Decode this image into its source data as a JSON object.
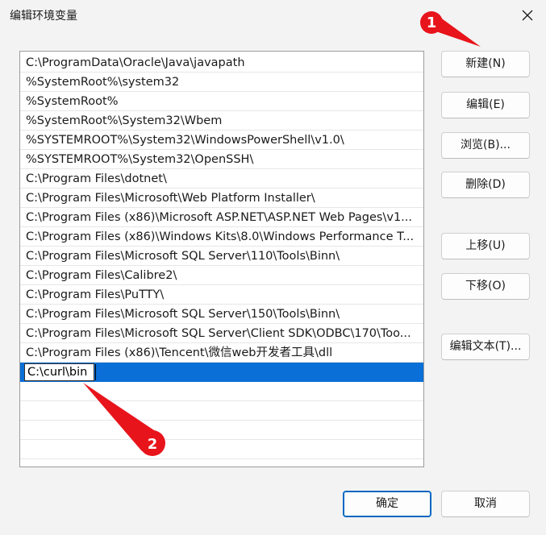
{
  "window": {
    "title": "编辑环境变量"
  },
  "paths": [
    "C:\\ProgramData\\Oracle\\Java\\javapath",
    "%SystemRoot%\\system32",
    "%SystemRoot%",
    "%SystemRoot%\\System32\\Wbem",
    "%SYSTEMROOT%\\System32\\WindowsPowerShell\\v1.0\\",
    "%SYSTEMROOT%\\System32\\OpenSSH\\",
    "C:\\Program Files\\dotnet\\",
    "C:\\Program Files\\Microsoft\\Web Platform Installer\\",
    "C:\\Program Files (x86)\\Microsoft ASP.NET\\ASP.NET Web Pages\\v1...",
    "C:\\Program Files (x86)\\Windows Kits\\8.0\\Windows Performance T...",
    "C:\\Program Files\\Microsoft SQL Server\\110\\Tools\\Binn\\",
    "C:\\Program Files\\Calibre2\\",
    "C:\\Program Files\\PuTTY\\",
    "C:\\Program Files\\Microsoft SQL Server\\150\\Tools\\Binn\\",
    "C:\\Program Files\\Microsoft SQL Server\\Client SDK\\ODBC\\170\\Too...",
    "C:\\Program Files (x86)\\Tencent\\微信web开发者工具\\dll"
  ],
  "editing": {
    "value": "C:\\curl\\bin"
  },
  "buttons": {
    "new": "新建(N)",
    "edit": "编辑(E)",
    "browse": "浏览(B)...",
    "delete": "删除(D)",
    "move_up": "上移(U)",
    "move_down": "下移(O)",
    "edit_text": "编辑文本(T)...",
    "ok": "确定",
    "cancel": "取消"
  },
  "annotations": {
    "badge1": "1",
    "badge2": "2"
  },
  "colors": {
    "selection": "#0a6fd6",
    "annotation": "#e8141b",
    "accent": "#0067c0"
  },
  "icons": {
    "close": "close-icon"
  }
}
